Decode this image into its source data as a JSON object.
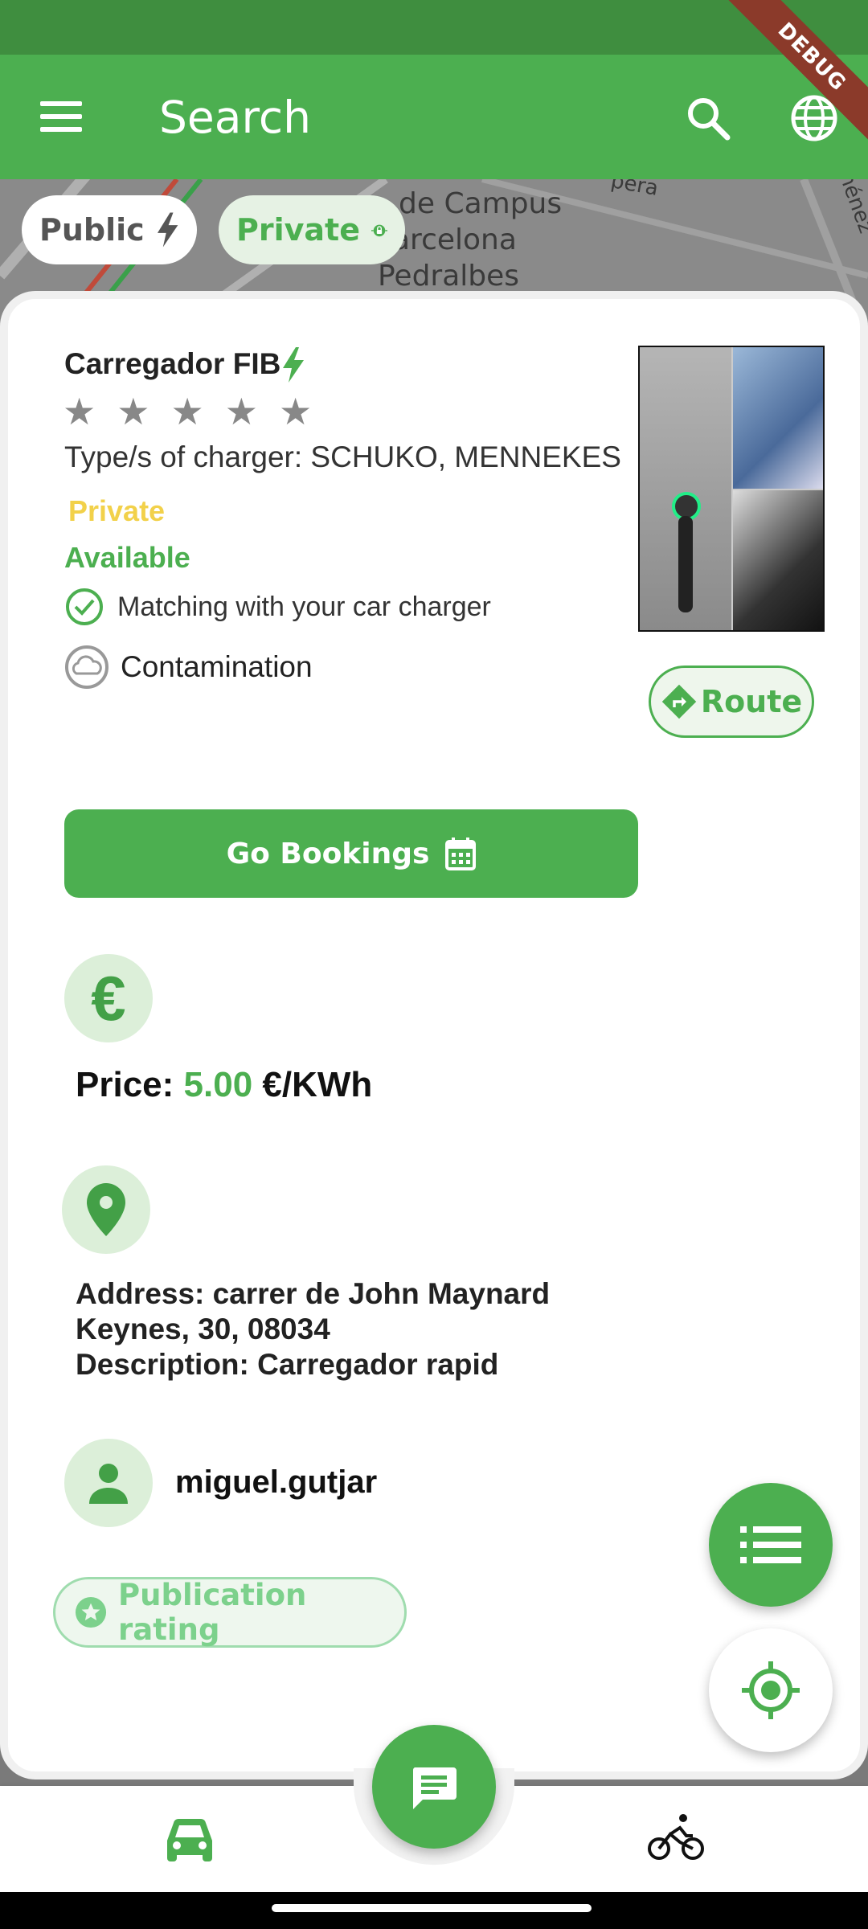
{
  "app_bar": {
    "title": "Search",
    "debug_label": "DEBUG"
  },
  "map": {
    "labels": [
      "de Campus",
      "arcelona",
      "Pedralbes",
      "pera",
      "ménez"
    ]
  },
  "filters": {
    "public_label": "Public",
    "private_label": "Private"
  },
  "charger": {
    "name": "Carregador FIB",
    "rating_stars": [
      "★",
      "★",
      "★",
      "★",
      "★"
    ],
    "rating_value": 0,
    "type_line": "Type/s of charger:  SCHUKO, MENNEKES",
    "access": "Private",
    "status": "Available",
    "matching": "Matching with your car charger",
    "contamination": "Contamination",
    "route_label": "Route",
    "bookings_label": "Go Bookings",
    "price_label": "Price:",
    "price_value": "5.00",
    "price_unit": "€/KWh",
    "euro_symbol": "€",
    "address_line": "Address:  carrer de John Maynard Keynes, 30, 08034",
    "description_line": "Description:  Carregador rapid",
    "owner": "miguel.gutjar",
    "publication_rating_label": "Publication rating"
  },
  "icons": {
    "menu": "menu-icon",
    "search": "search-icon",
    "globe": "globe-icon",
    "bolt": "bolt-icon",
    "lock": "lock-icon",
    "check": "check-circle-icon",
    "cloud": "cloud-icon",
    "route": "route-icon",
    "calendar": "calendar-icon",
    "pin": "pin-icon",
    "user": "user-icon",
    "star": "star-icon",
    "list": "list-icon",
    "locate": "locate-icon",
    "chat": "chat-icon",
    "car": "car-icon",
    "bike": "bike-icon"
  },
  "colors": {
    "primary": "#4caf50",
    "status_bar": "#3f8e3f",
    "private_yellow": "#f2d14a",
    "chip_tint": "#dcefd9"
  }
}
